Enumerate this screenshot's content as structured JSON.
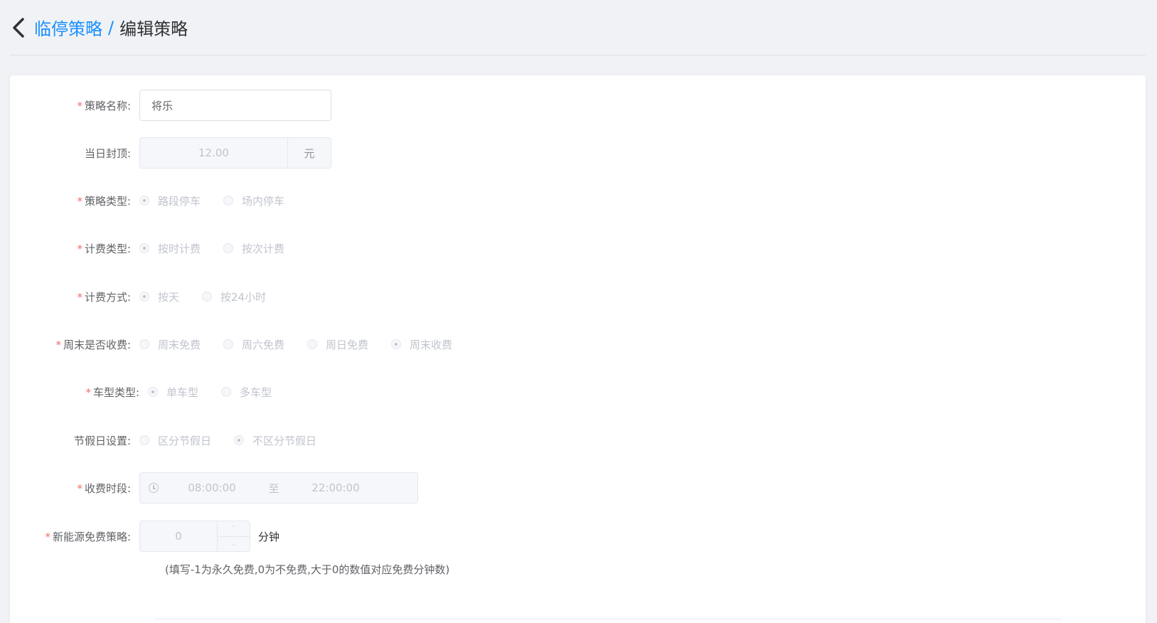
{
  "breadcrumb": {
    "parent": "临停策略",
    "separator": "/",
    "current": "编辑策略"
  },
  "form": {
    "name": {
      "label": "策略名称:",
      "required": true,
      "value": "将乐"
    },
    "daily_cap": {
      "label": "当日封顶:",
      "required": false,
      "value": "12.00",
      "unit": "元"
    },
    "strategy_type": {
      "label": "策略类型:",
      "required": true,
      "options": [
        "路段停车",
        "场内停车"
      ],
      "selected": 0
    },
    "billing_type": {
      "label": "计费类型:",
      "required": true,
      "options": [
        "按时计费",
        "按次计费"
      ],
      "selected": 0
    },
    "billing_mode": {
      "label": "计费方式:",
      "required": true,
      "options": [
        "按天",
        "按24小时"
      ],
      "selected": 0
    },
    "weekend_charge": {
      "label": "周末是否收费:",
      "required": true,
      "options": [
        "周末免费",
        "周六免费",
        "周日免费",
        "周末收费"
      ],
      "selected": 3
    },
    "vehicle_type": {
      "label": "车型类型:",
      "required": true,
      "options": [
        "单车型",
        "多车型"
      ],
      "selected": 0
    },
    "holiday": {
      "label": "节假日设置:",
      "required": false,
      "options": [
        "区分节假日",
        "不区分节假日"
      ],
      "selected": 1
    },
    "charge_period": {
      "label": "收费时段:",
      "required": true,
      "start": "08:00:00",
      "separator": "至",
      "end": "22:00:00"
    },
    "nev_free": {
      "label": "新能源免费策略:",
      "required": true,
      "value": "0",
      "unit": "分钟",
      "hint": "(填写-1为永久免费,0为不免费,大于0的数值对应免费分钟数)"
    }
  },
  "icons": {
    "back": "chevron-left-icon",
    "clock": "clock-icon"
  },
  "colors": {
    "link": "#1890ff",
    "required": "#f56c6c",
    "disabled_text": "#c0c4cc"
  }
}
